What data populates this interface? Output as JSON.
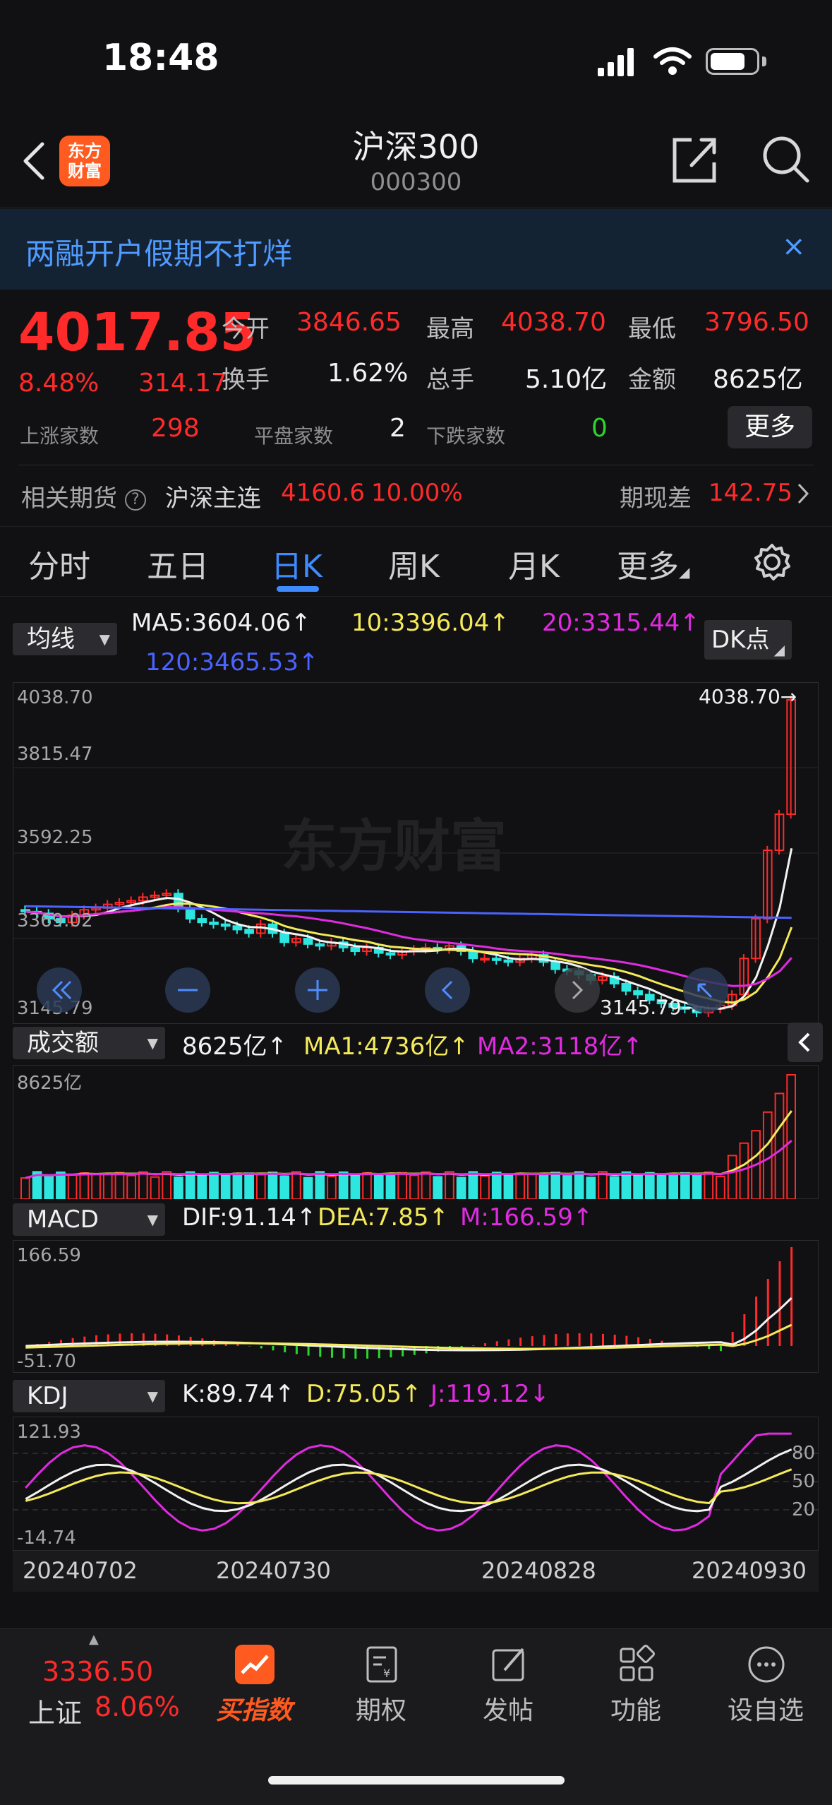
{
  "status_bar": {
    "time": "18:48"
  },
  "header": {
    "title": "沪深300",
    "code": "000300",
    "logo_text_1": "东方",
    "logo_text_2": "财富"
  },
  "banner": {
    "text": "两融开户假期不打烊",
    "close": "×"
  },
  "quote": {
    "price": "4017.85",
    "change_pct": "8.48%",
    "change_abs": "314.17",
    "open_label": "今开",
    "open": "3846.65",
    "high_label": "最高",
    "high": "4038.70",
    "low_label": "最低",
    "low": "3796.50",
    "turnover_label": "换手",
    "turnover": "1.62%",
    "volume_label": "总手",
    "volume": "5.10亿",
    "amount_label": "金额",
    "amount": "8625亿",
    "rise_label": "上涨家数",
    "rise": "298",
    "flat_label": "平盘家数",
    "flat": "2",
    "fall_label": "下跌家数",
    "fall": "0",
    "more": "更多",
    "futures_label": "相关期货",
    "futures_name": "沪深主连",
    "futures_price": "4160.6",
    "futures_pct": "10.00%",
    "basis_label": "期现差",
    "basis": "142.75"
  },
  "tabs": [
    {
      "label": "分时",
      "active": false
    },
    {
      "label": "五日",
      "active": false
    },
    {
      "label": "日K",
      "active": true
    },
    {
      "label": "周K",
      "active": false
    },
    {
      "label": "月K",
      "active": false
    },
    {
      "label": "更多",
      "active": false
    }
  ],
  "ma": {
    "selector": "均线",
    "ma5": "MA5:3604.06↑",
    "ma10": "10:3396.04↑",
    "ma20": "20:3315.44↑",
    "ma120": "120:3465.53↑",
    "dk": "DK点"
  },
  "kline": {
    "y_labels": [
      "4038.70",
      "3815.47",
      "3592.25",
      "3369.02",
      "3145.79"
    ],
    "max_label": "4038.70→",
    "min_label": "3145.79→"
  },
  "volume": {
    "selector": "成交额",
    "value": "8625亿↑",
    "ma1": "MA1:4736亿↑",
    "ma2": "MA2:3118亿↑",
    "y_label": "8625亿"
  },
  "macd": {
    "selector": "MACD",
    "dif": "DIF:91.14↑",
    "dea": "DEA:7.85↑",
    "m": "M:166.59↑",
    "y_top": "166.59",
    "y_bottom": "-51.70"
  },
  "kdj": {
    "selector": "KDJ",
    "k": "K:89.74↑",
    "d": "D:75.05↑",
    "j": "J:119.12↓",
    "y_top": "121.93",
    "y_bottom": "-14.74",
    "levels": [
      "80",
      "50",
      "20"
    ]
  },
  "dates": [
    "20240702",
    "20240730",
    "20240828",
    "20240930"
  ],
  "bottom_nav": {
    "index_value": "3336.50",
    "index_name": "上证",
    "index_pct": "8.06%",
    "items": [
      "买指数",
      "期权",
      "发帖",
      "功能",
      "设自选"
    ]
  },
  "colors": {
    "up": "#ff2a2a",
    "down": "#2ee6e0",
    "accent": "#3d8bff",
    "bg": "#111113"
  },
  "chart_data": {
    "type": "candlestick",
    "series_count": 66,
    "closes": [
      3430,
      3425,
      3410,
      3400,
      3420,
      3435,
      3440,
      3450,
      3455,
      3460,
      3470,
      3475,
      3480,
      3440,
      3410,
      3400,
      3395,
      3390,
      3380,
      3370,
      3395,
      3370,
      3345,
      3355,
      3340,
      3335,
      3345,
      3330,
      3320,
      3330,
      3315,
      3310,
      3320,
      3325,
      3330,
      3325,
      3335,
      3320,
      3300,
      3300,
      3295,
      3290,
      3300,
      3310,
      3290,
      3270,
      3265,
      3255,
      3240,
      3250,
      3230,
      3210,
      3200,
      3185,
      3175,
      3165,
      3160,
      3150,
      3160,
      3170,
      3200,
      3300,
      3410,
      3600,
      3700,
      4017
    ]
  }
}
